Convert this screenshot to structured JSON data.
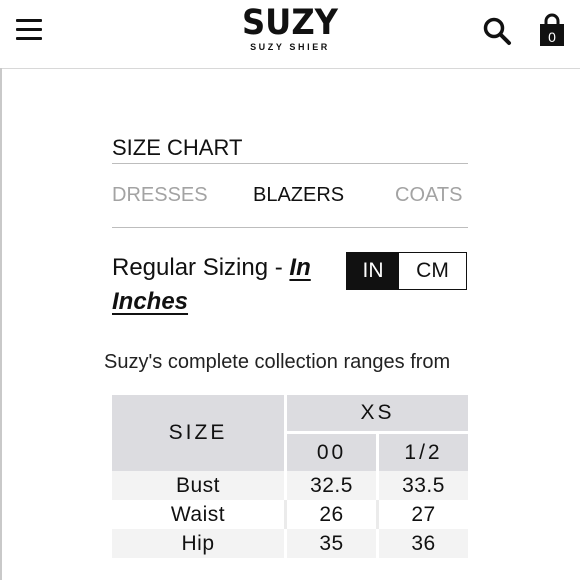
{
  "header": {
    "brand": "SUZY",
    "brand_sub": "SUZY SHIER",
    "cart_count": "0",
    "icons": [
      "menu-icon",
      "search-icon",
      "shopping-bag-icon"
    ]
  },
  "size_chart": {
    "title": "SIZE CHART",
    "tabs": [
      {
        "label": "DRESSES",
        "active": false
      },
      {
        "label": "BLAZERS",
        "active": true
      },
      {
        "label": "COATS",
        "active": false
      }
    ],
    "sizing_prefix": "Regular Sizing - ",
    "sizing_unit": "In Inches",
    "unit_toggle": {
      "in_label": "IN",
      "cm_label": "CM",
      "selected": "IN"
    },
    "description": "Suzy's complete collection ranges from",
    "table": {
      "size_header": "SIZE",
      "group_header": "XS",
      "sub_headers": [
        "00",
        "1/2"
      ],
      "rows": [
        {
          "label": "Bust",
          "values": [
            "32.5",
            "33.5"
          ]
        },
        {
          "label": "Waist",
          "values": [
            "26",
            "27"
          ]
        },
        {
          "label": "Hip",
          "values": [
            "35",
            "36"
          ]
        }
      ]
    }
  },
  "colors": {
    "header_cell": "#dcdce0",
    "active_toggle": "#111111",
    "inactive_tab": "#a3a3a3"
  }
}
